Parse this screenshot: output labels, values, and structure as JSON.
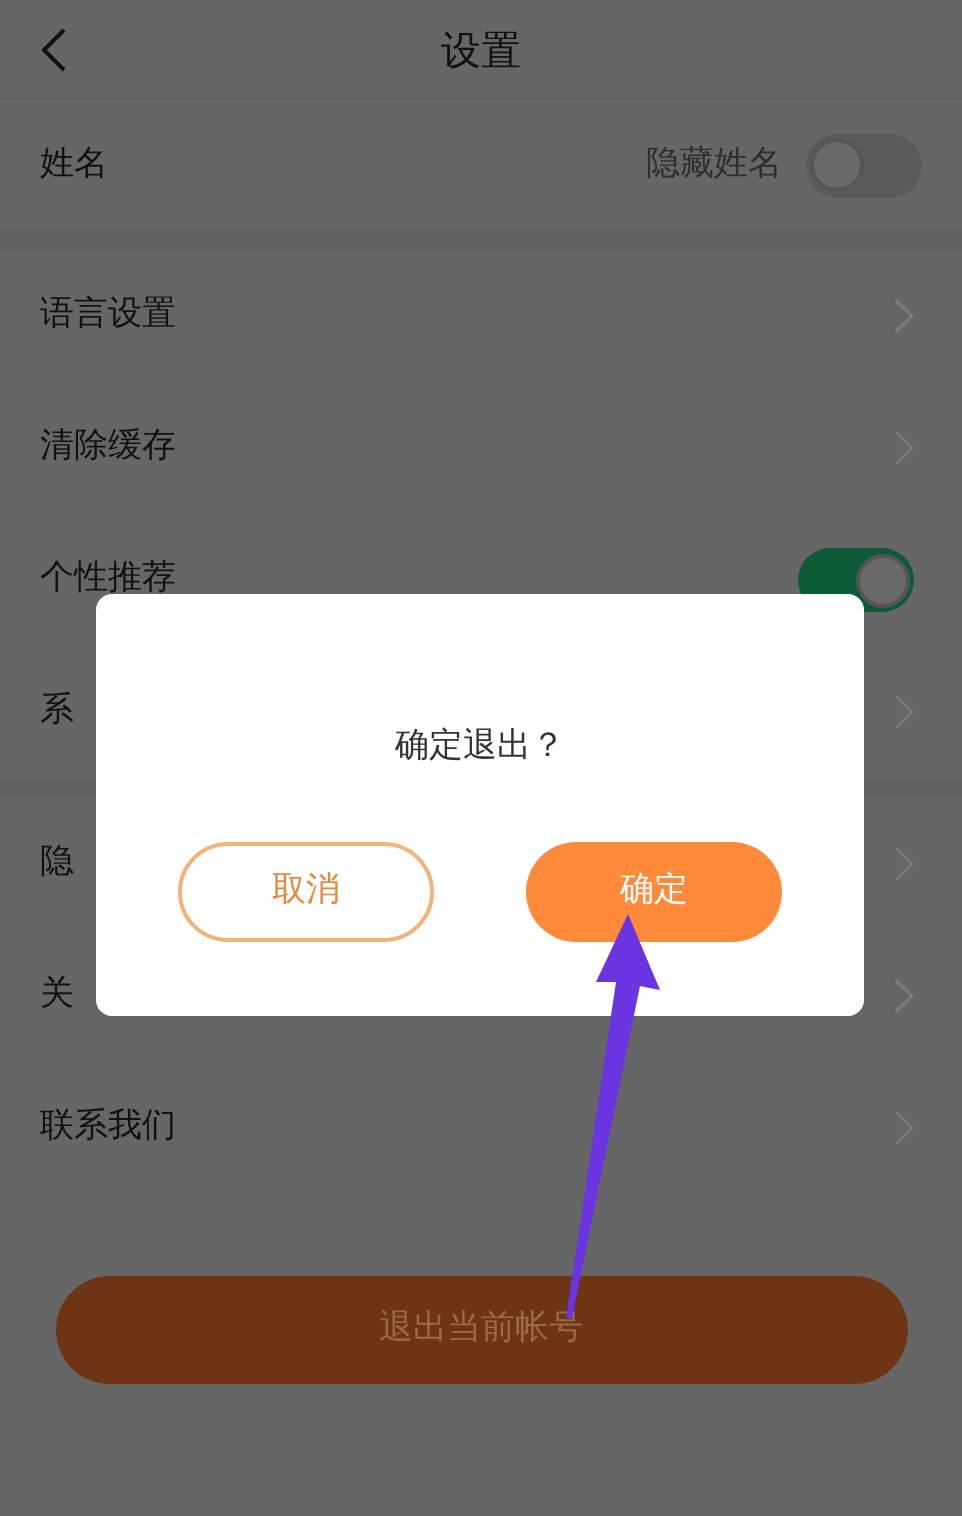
{
  "header": {
    "title": "设置"
  },
  "name_row": {
    "label": "姓名",
    "hide_label": "隐藏姓名",
    "hide_on": false
  },
  "groups": [
    [
      {
        "label": "语言设置",
        "kind": "link"
      },
      {
        "label": "清除缓存",
        "kind": "link"
      },
      {
        "label": "个性推荐",
        "kind": "toggle",
        "on": true
      },
      {
        "label": "系",
        "kind": "link"
      }
    ],
    [
      {
        "label": "隐",
        "kind": "link"
      },
      {
        "label": "关",
        "kind": "link"
      },
      {
        "label": "联系我们",
        "kind": "link"
      }
    ]
  ],
  "logout_button": "退出当前帐号",
  "dialog": {
    "message": "确定退出？",
    "buttons": [
      {
        "label": "取消",
        "kind": "outline"
      },
      {
        "label": "确定",
        "kind": "primary"
      }
    ]
  }
}
